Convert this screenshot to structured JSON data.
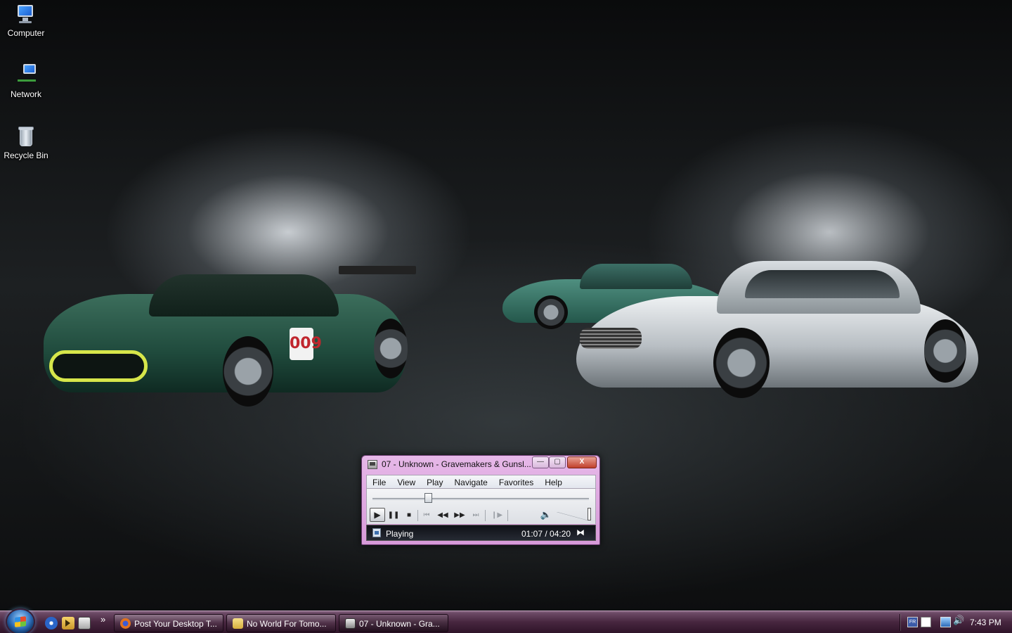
{
  "desktop": {
    "icons": [
      {
        "label": "Computer",
        "icon": "computer-icon"
      },
      {
        "label": "Network",
        "icon": "network-icon"
      },
      {
        "label": "Recycle Bin",
        "icon": "recycle-bin-icon"
      }
    ],
    "wallpaper": {
      "race_car_number": "009"
    }
  },
  "player": {
    "title": "07 - Unknown - Gravemakers & Gunsl...",
    "window_buttons": {
      "minimize": "—",
      "maximize": "▢",
      "close": "X"
    },
    "menu": [
      "File",
      "View",
      "Play",
      "Navigate",
      "Favorites",
      "Help"
    ],
    "seek_fraction": 0.257,
    "controls": {
      "play": "▶",
      "pause": "❚❚",
      "stop": "■",
      "previous": "⏮",
      "rewind": "◀◀",
      "fast_forward": "▶▶",
      "next": "⏭",
      "frame_step": "❙▶",
      "mute": "🔈"
    },
    "status": "Playing",
    "time": "01:07 / 04:20",
    "view_switch": "⧓"
  },
  "taskbar": {
    "quick_launch_more": "»",
    "tasks": [
      {
        "label": "Post Your Desktop T...",
        "icon": "firefox-icon"
      },
      {
        "label": "No World For Tomo...",
        "icon": "folder-icon"
      },
      {
        "label": "07 - Unknown - Gra...",
        "icon": "media-player-icon"
      }
    ],
    "tray": {
      "language": "FR",
      "volume_glyph": "🔊",
      "clock": "7:43 PM"
    }
  },
  "colors": {
    "taskbar_top": "#8c6a86",
    "taskbar_bottom": "#2f1429",
    "player_frame": "#d79ad9",
    "close_button": "#c1402b"
  }
}
